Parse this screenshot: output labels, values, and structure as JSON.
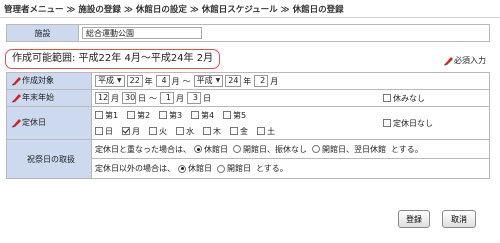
{
  "breadcrumb": [
    "管理者メニュー",
    "施設の登録",
    "休館日の設定",
    "休館日スケジュール",
    "休館日の登録"
  ],
  "breadcrumb_sep": "≫",
  "facility": {
    "label": "施設",
    "value": "総合運動公園"
  },
  "range_text": "作成可能範囲: 平成22年 4月～平成24年 2月",
  "required_note": "必須入力",
  "target": {
    "label": "作成対象",
    "from_era": "平成",
    "from_year": "22",
    "year_unit": "年",
    "from_month": "4",
    "month_unit": "月",
    "tilde": "～",
    "to_era": "平成",
    "to_year": "24",
    "to_month": "2"
  },
  "year_end": {
    "label": "年末年始",
    "from_month": "12",
    "from_day": "30",
    "month_unit": "月",
    "day_unit": "日",
    "tilde": "～",
    "to_month": "1",
    "to_day": "3",
    "none_label": "休みなし"
  },
  "regular": {
    "label": "定休日",
    "weeks": [
      "第1",
      "第2",
      "第3",
      "第4",
      "第5"
    ],
    "days": [
      "日",
      "月",
      "火",
      "水",
      "木",
      "金",
      "土"
    ],
    "days_checked": [
      false,
      true,
      false,
      false,
      false,
      false,
      false
    ],
    "none_label": "定休日なし"
  },
  "holiday": {
    "label": "祝祭日の取扱",
    "row1_prefix": "定休日と重なった場合は、",
    "row1_options": [
      "休館日",
      "開館日、振休なし",
      "開館日、翌日休館"
    ],
    "row1_selected": 0,
    "row1_suffix": "とする。",
    "row2_prefix": "定休日以外の場合は、",
    "row2_options": [
      "休館日",
      "開館日"
    ],
    "row2_selected": 0,
    "row2_suffix": "とする。"
  },
  "buttons": {
    "register": "登録",
    "cancel": "取消"
  },
  "colors": {
    "label_bg": "#ccd9ef",
    "range_border": "#e05050",
    "pen_red": "#d22222"
  }
}
